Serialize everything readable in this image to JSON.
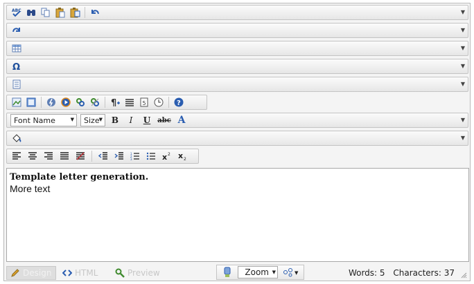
{
  "font_name": {
    "value": "Font Name"
  },
  "font_size": {
    "value": "Size"
  },
  "format_buttons": {
    "bold": "B",
    "italic": "I",
    "underline": "U",
    "strike": "abc",
    "font_color": "A"
  },
  "content": {
    "line1": "Template letter generation.",
    "line2": "More text"
  },
  "modes": {
    "design": "Design",
    "html": "HTML",
    "preview": "Preview"
  },
  "zoom": {
    "label": "Zoom"
  },
  "status": {
    "words": "Words: 5",
    "characters": "Characters: 37"
  },
  "colors": {
    "accent_blue": "#2a5db0",
    "toolbar_border": "#c4c4c4",
    "content_border": "#a8a8a8"
  }
}
